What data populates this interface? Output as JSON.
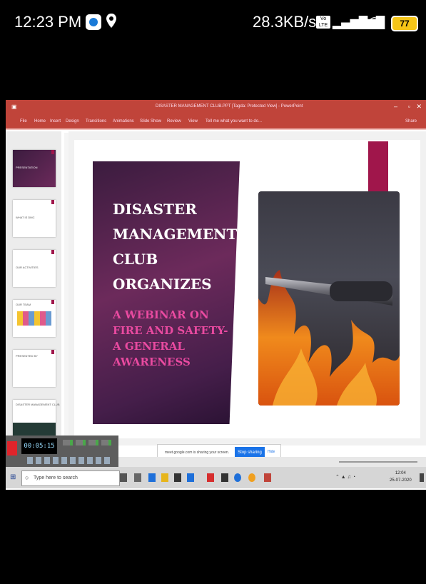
{
  "phone_status": {
    "time": "12:23 PM",
    "net_speed": "28.3KB/s",
    "volte_badge": "Vo LTE",
    "battery": "77"
  },
  "powerpoint": {
    "title": "DISASTER MANAGEMENT CLUB.PPT [Tagda: Protected View] - PowerPoint",
    "ribbon_tabs": [
      "File",
      "Home",
      "Insert",
      "Design",
      "Transitions",
      "Animations",
      "Slide Show",
      "Review",
      "View"
    ],
    "tell_me": "Tell me what you want to do...",
    "share": "Share",
    "thumbnails": [
      "PRESENTATION",
      "WHAT IS DMC",
      "OUR ACTIVITIES",
      "OUR TEAM",
      "PRESENTED BY",
      "DISASTER MANAGEMENT CLUB"
    ]
  },
  "slide": {
    "heading_lines": [
      "DISASTER",
      "MANAGEMENT",
      "CLUB",
      "ORGANIZES"
    ],
    "subheading_lines": [
      "A WEBINAR ON",
      "FIRE AND SAFETY-",
      "A GENERAL",
      "AWARENESS"
    ]
  },
  "screen_share": {
    "message": "meet.google.com is sharing your screen.",
    "stop_button": "Stop sharing",
    "hide_link": "Hide"
  },
  "recorder": {
    "timer": "00:05:15"
  },
  "taskbar": {
    "search_placeholder": "Type here to search",
    "time": "12:04",
    "date": "25-07-2020"
  },
  "colors": {
    "ribbon": "#c0443a",
    "accent": "#a0164b",
    "subhead": "#e94aa0",
    "stop_button": "#1a73e8"
  }
}
